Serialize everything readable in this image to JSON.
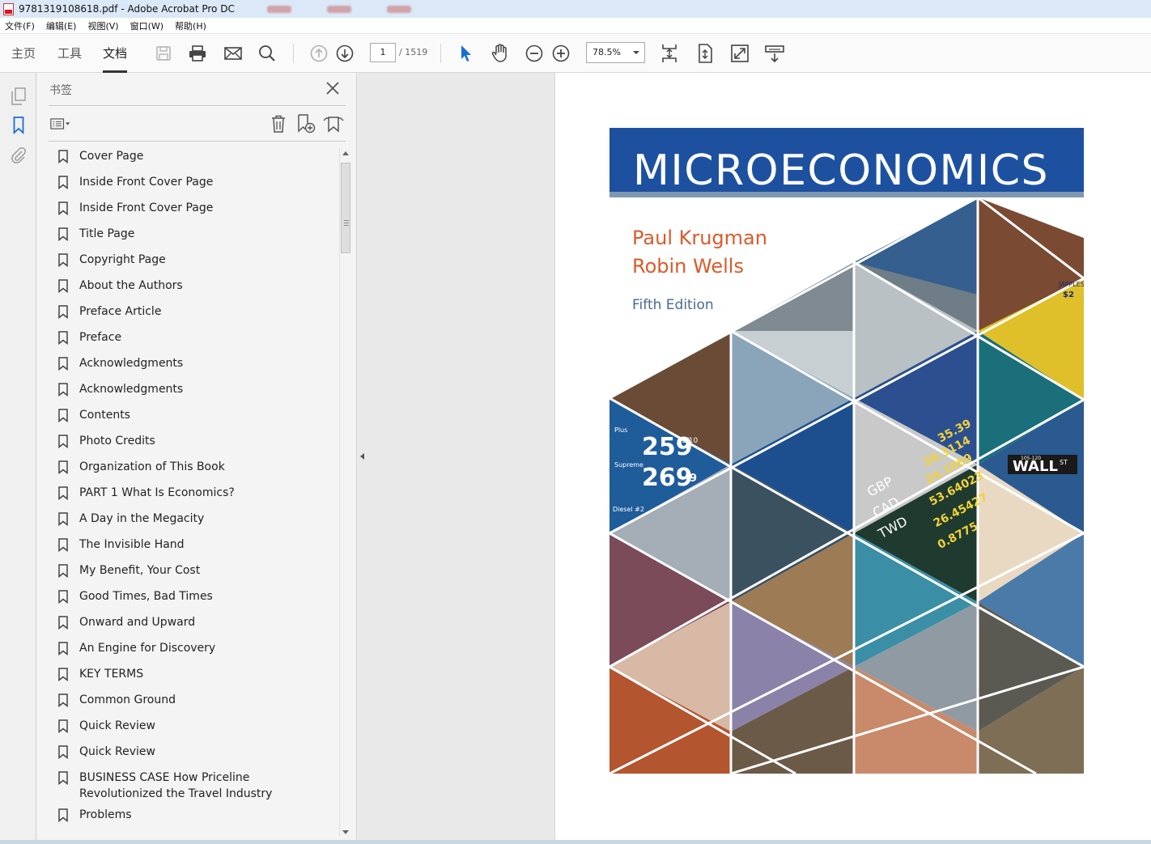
{
  "window": {
    "title": "9781319108618.pdf - Adobe Acrobat Pro DC"
  },
  "menu": {
    "items": [
      "文件(F)",
      "编辑(E)",
      "视图(V)",
      "窗口(W)",
      "帮助(H)"
    ]
  },
  "toolbar": {
    "tabs": [
      "主页",
      "工具",
      "文档"
    ],
    "active_tab": "文档",
    "page_current": "1",
    "page_total": "/ 1519",
    "zoom": "78.5%",
    "icons": [
      "save-icon",
      "print-icon",
      "email-icon",
      "search-icon",
      "page-up-icon",
      "page-down-icon",
      "select-cursor-icon",
      "hand-tool-icon",
      "zoom-out-icon",
      "zoom-in-icon",
      "fit-page-icon",
      "scroll-mode-icon",
      "full-screen-icon",
      "read-mode-icon"
    ]
  },
  "panel": {
    "title": "书签",
    "bookmarks": [
      "Cover Page",
      "Inside Front Cover Page",
      "Inside Front Cover Page",
      "Title Page",
      "Copyright Page",
      "About the Authors",
      "Preface Article",
      "Preface",
      "Acknowledgments",
      "Acknowledgments",
      "Contents",
      "Photo Credits",
      "Organization of This Book",
      "PART 1 What Is Economics?",
      "A Day in the Megacity",
      "The Invisible Hand",
      "My Benefit, Your Cost",
      "Good Times, Bad Times",
      "Onward and Upward",
      "An Engine for Discovery",
      "KEY TERMS",
      "Common Ground",
      "Quick Review",
      "Quick Review",
      "BUSINESS CASE How Priceline Revolutionized the Travel Industry",
      "Problems"
    ]
  },
  "cover": {
    "title": "MICROECONOMICS",
    "author1": "Paul Krugman",
    "author2": "Robin Wells",
    "edition": "Fifth Edition",
    "title_bar_color": "#1d51a0",
    "author_color": "#dc5a2a",
    "photo_text": {
      "price1": "259",
      "price2": "269",
      "price1_fraction": "9/10",
      "price2_fraction": "9",
      "grade1": "Plus",
      "grade2": "Supreme",
      "grade3": "Diesel #2",
      "street_sign": "WALL",
      "street_sign_suffix": "ST",
      "street_number": "105-120",
      "market_stall": "JAPPLES",
      "stall_price": "$2",
      "currency_codes": [
        "GBP",
        "CAD",
        "TWD"
      ],
      "exchange_rates": [
        "35.39",
        "39.3114",
        "24.1069",
        "53.64023",
        "26.45427",
        "0.8775"
      ]
    }
  }
}
